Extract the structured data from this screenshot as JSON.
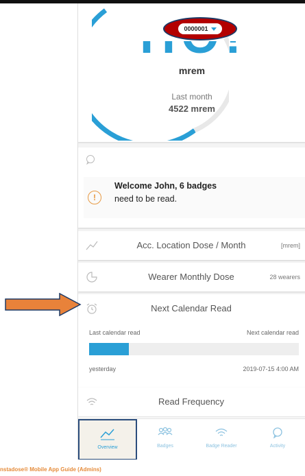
{
  "header": {
    "badge_id": "0000001",
    "dose_unit": "mrem",
    "last_month_label": "Last month",
    "last_month_value": "4522 mrem"
  },
  "welcome": {
    "line1": "Welcome John, 6 badges",
    "line2": "need to be read."
  },
  "sections": {
    "acc_location": {
      "title": "Acc. Location Dose / Month",
      "aside": "[mrem]"
    },
    "wearer_monthly": {
      "title": "Wearer Monthly Dose",
      "aside": "28 wearers"
    },
    "next_calendar": {
      "title": "Next Calendar Read",
      "last_label": "Last calendar read",
      "next_label": "Next calendar read",
      "last_value": "yesterday",
      "next_value": "2019-07-15 4:00 AM",
      "progress_fraction": 0.19
    },
    "read_frequency": {
      "title": "Read Frequency"
    }
  },
  "nav": {
    "overview": "Overview",
    "badges": "Badges",
    "badge_reader": "Badge Reader",
    "activity": "Activity"
  },
  "colors": {
    "accent": "#2a9fd6",
    "highlight_ring": "#b30000",
    "arrow": "#e8823a",
    "warning": "#e79a44"
  },
  "footer": {
    "text": "nstadose® Mobile App Guide (Admins)"
  }
}
